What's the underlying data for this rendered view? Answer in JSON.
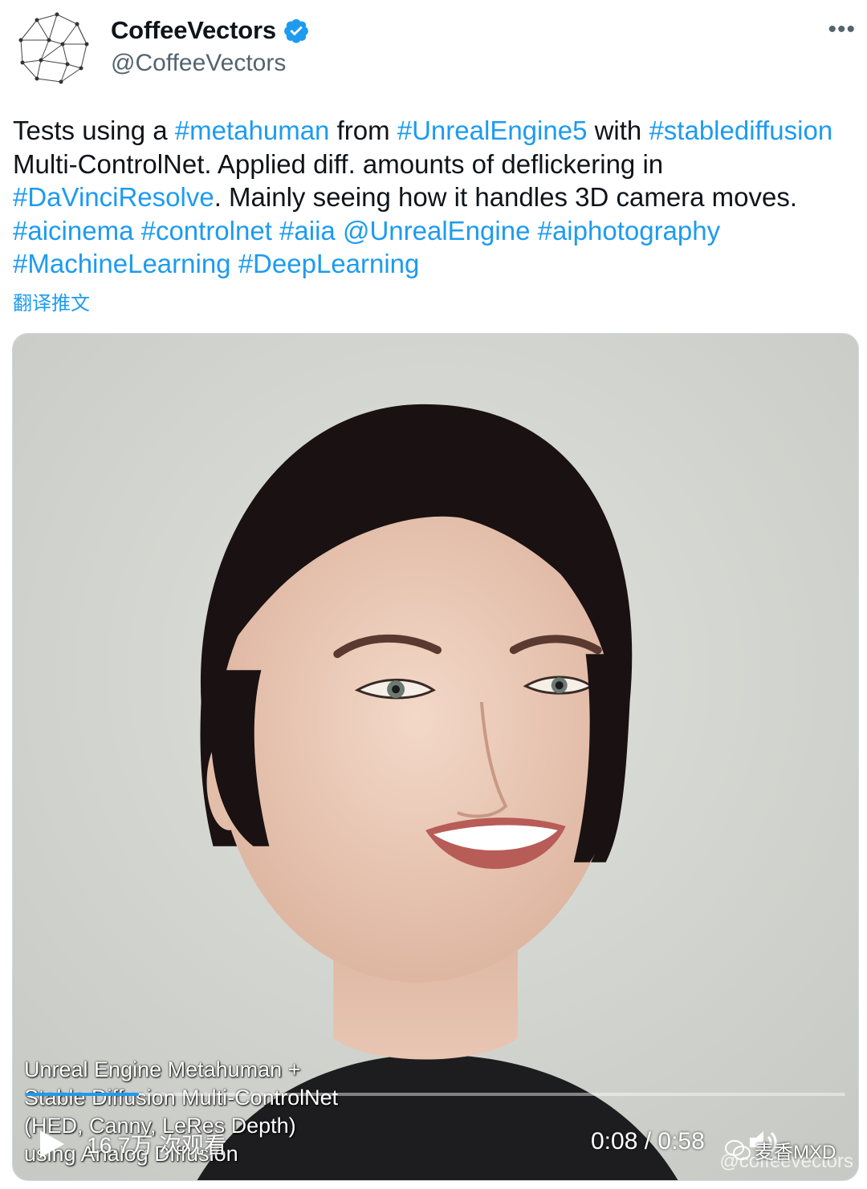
{
  "author": {
    "name": "CoffeeVectors",
    "handle": "@CoffeeVectors",
    "verified": true,
    "avatar_icon": "network-mesh-avatar"
  },
  "more_menu": "•••",
  "tweet": {
    "segments": [
      {
        "text": "Tests using a ",
        "link": false
      },
      {
        "text": "#metahuman",
        "link": true
      },
      {
        "text": " from ",
        "link": false
      },
      {
        "text": "#UnrealEngine5",
        "link": true
      },
      {
        "text": " with ",
        "link": false
      },
      {
        "text": "#stablediffusion",
        "link": true
      },
      {
        "text": " Multi-ControlNet. Applied diff. amounts of deflickering in ",
        "link": false
      },
      {
        "text": "#DaVinciResolve",
        "link": true
      },
      {
        "text": ". Mainly seeing how it handles 3D camera moves. ",
        "link": false
      },
      {
        "text": "#aicinema",
        "link": true
      },
      {
        "text": " ",
        "link": false
      },
      {
        "text": "#controlnet",
        "link": true
      },
      {
        "text": " ",
        "link": false
      },
      {
        "text": "#aiia",
        "link": true
      },
      {
        "text": " ",
        "link": false
      },
      {
        "text": "@UnrealEngine",
        "link": true
      },
      {
        "text": " ",
        "link": false
      },
      {
        "text": "#aiphotography",
        "link": true
      },
      {
        "text": " ",
        "link": false
      },
      {
        "text": "#MachineLearning",
        "link": true
      },
      {
        "text": " ",
        "link": false
      },
      {
        "text": "#DeepLearning",
        "link": true
      }
    ],
    "translate_label": "翻译推文"
  },
  "video": {
    "caption_lines": [
      "Unreal Engine Metahuman +",
      "Stable Diffusion Multi-ControlNet",
      "(HED, Canny, LeRes Depth)",
      "using Analog Diffusion"
    ],
    "views": "16.7万 次观看",
    "time": "0:08 / 0:58",
    "progress_fraction": 0.138,
    "watermark": "@coffeevectors",
    "overlay_brand": "麦香MXD"
  },
  "colors": {
    "link": "#1d9bf0",
    "text": "#0f1419",
    "secondary": "#536471"
  }
}
